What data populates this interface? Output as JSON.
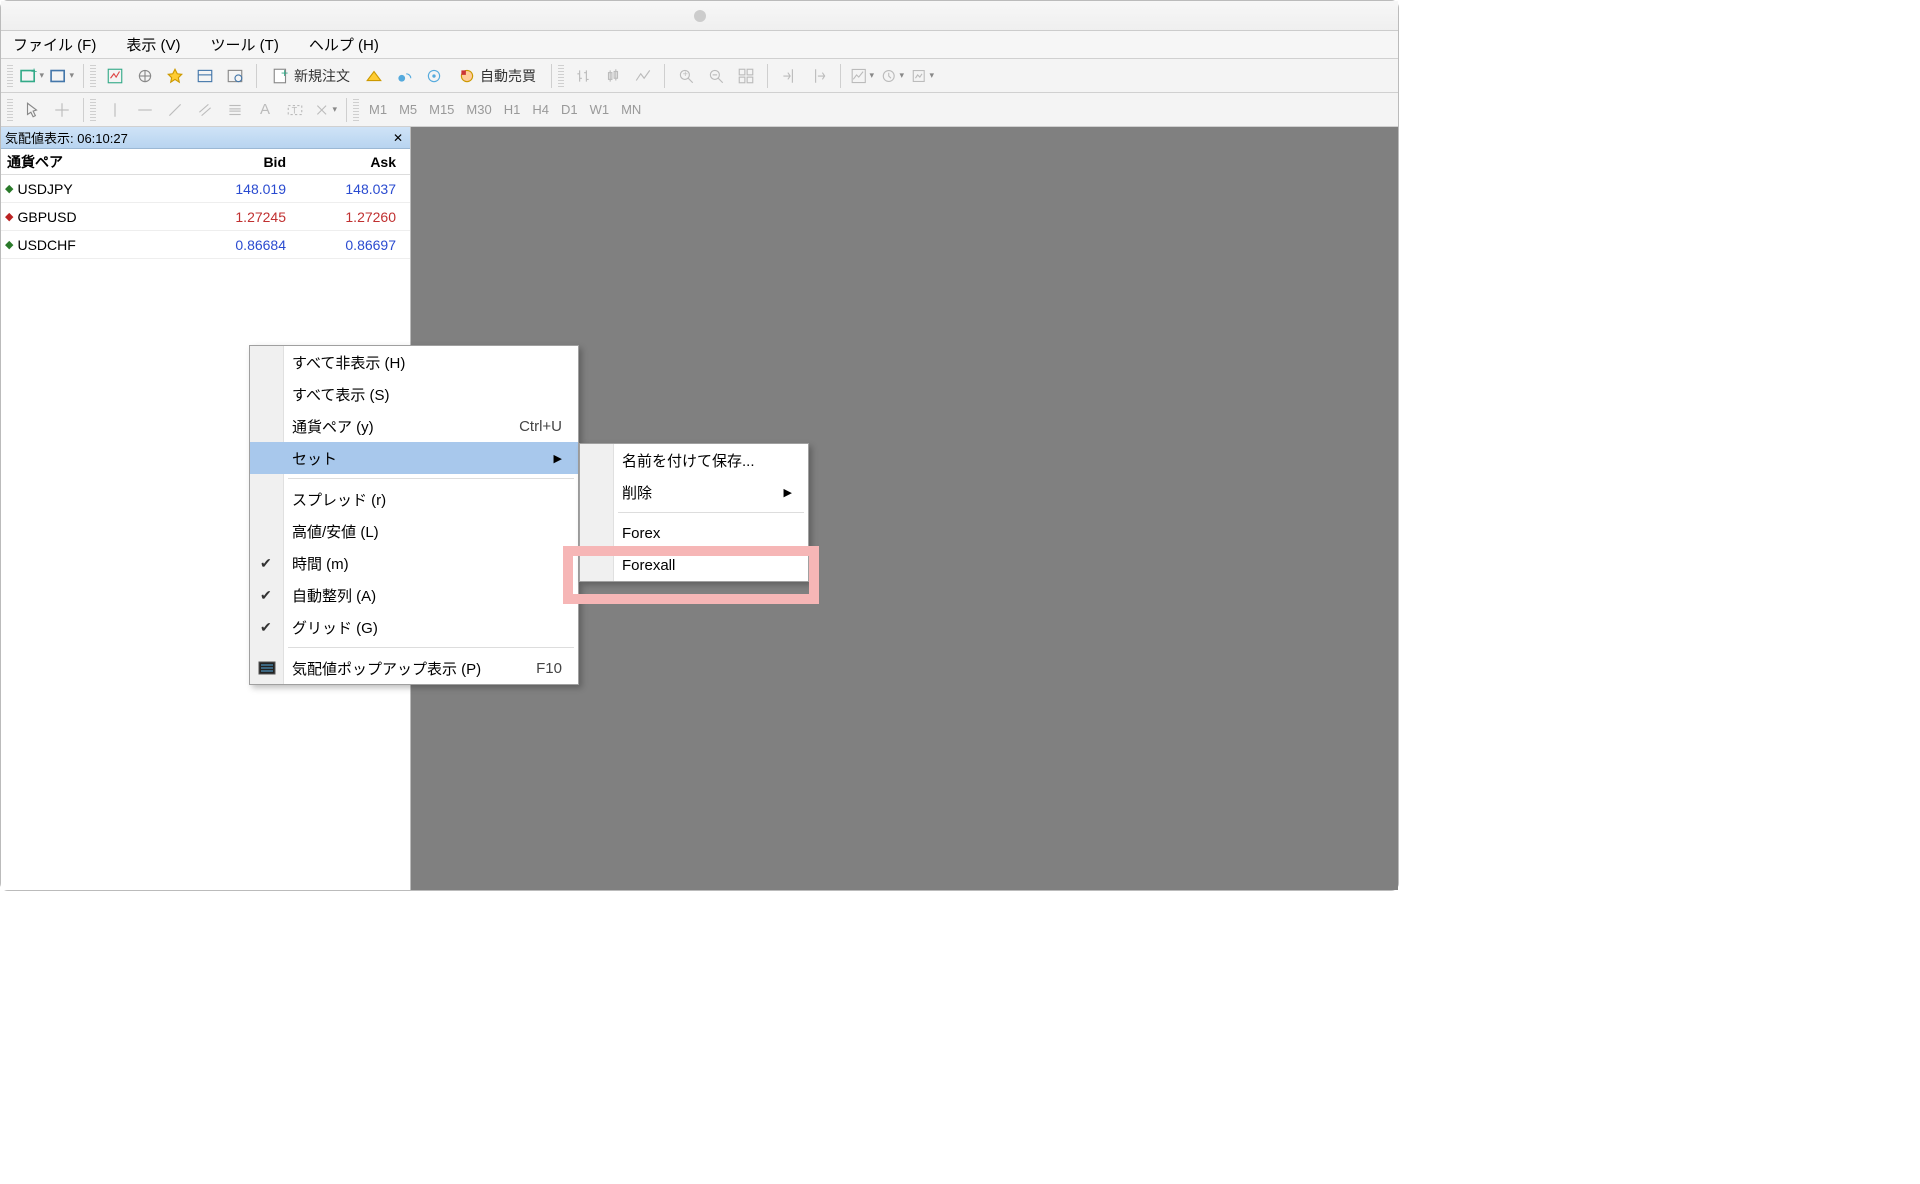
{
  "menubar": {
    "file": "ファイル (F)",
    "view": "表示 (V)",
    "tools": "ツール (T)",
    "help": "ヘルプ (H)"
  },
  "toolbar": {
    "new_order": "新規注文",
    "auto_trade": "自動売買"
  },
  "timeframes": [
    "M1",
    "M5",
    "M15",
    "M30",
    "H1",
    "H4",
    "D1",
    "W1",
    "MN"
  ],
  "panel": {
    "title": "気配値表示: 06:10:27",
    "cols": {
      "symbol": "通貨ペア",
      "bid": "Bid",
      "ask": "Ask"
    },
    "rows": [
      {
        "sym": "USDJPY",
        "dir": "up",
        "bid": "148.019",
        "ask": "148.037",
        "cls": "price-blue"
      },
      {
        "sym": "GBPUSD",
        "dir": "down",
        "bid": "1.27245",
        "ask": "1.27260",
        "cls": "price-red"
      },
      {
        "sym": "USDCHF",
        "dir": "up",
        "bid": "0.86684",
        "ask": "0.86697",
        "cls": "price-blue"
      }
    ]
  },
  "ctx1": {
    "hide_all": "すべて非表示 (H)",
    "show_all": "すべて表示 (S)",
    "symbols": "通貨ペア (y)",
    "symbols_sc": "Ctrl+U",
    "set": "セット",
    "spread": "スプレッド (r)",
    "highlow": "高値/安値 (L)",
    "time": "時間 (m)",
    "autoarrange": "自動整列 (A)",
    "grid": "グリッド (G)",
    "popup": "気配値ポップアップ表示 (P)",
    "popup_sc": "F10"
  },
  "ctx2": {
    "save_as": "名前を付けて保存...",
    "delete": "削除",
    "forex": "Forex",
    "forexall": "Forexall"
  }
}
